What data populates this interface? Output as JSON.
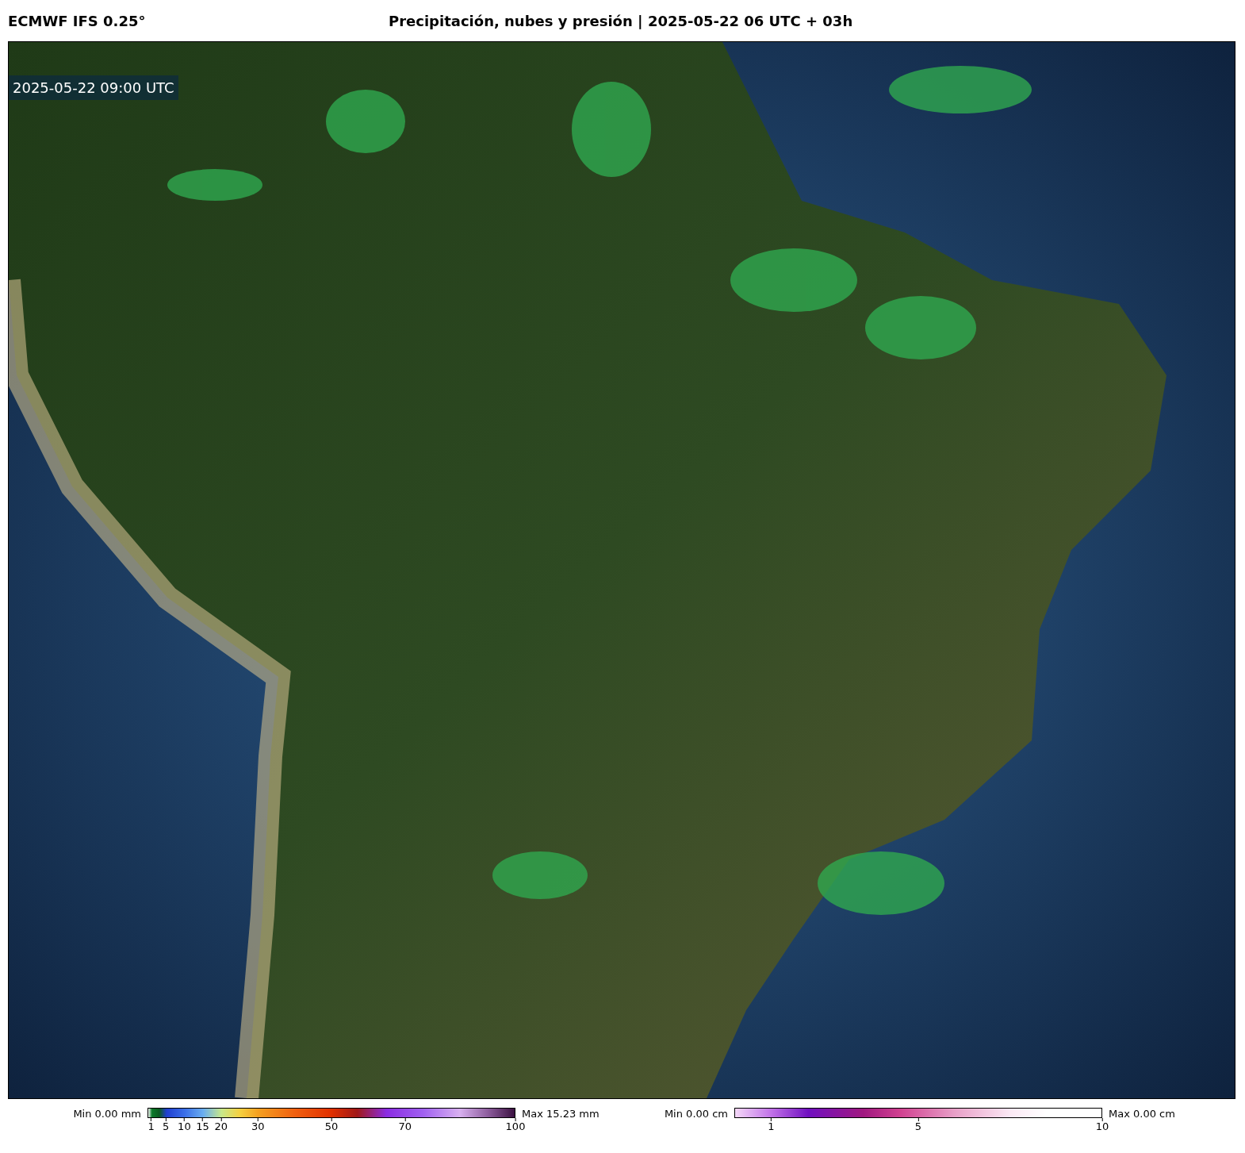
{
  "header": {
    "model": "ECMWF IFS 0.25°",
    "title": "Precipitación, nubes y presión | 2025-05-22 06 UTC + 03h"
  },
  "map": {
    "valid_time": "2025-05-22 09:00 UTC"
  },
  "legends": [
    {
      "kind": "rain",
      "min": "Min 0.00 mm",
      "max": "Max 15.23 mm",
      "ticks": [
        "1",
        "5",
        "10",
        "15",
        "20",
        "30",
        "50",
        "70",
        "100"
      ]
    },
    {
      "kind": "snow",
      "min": "Min 0.00 cm",
      "max": "Max 0.00 cm",
      "ticks": [
        "1",
        "5",
        "10"
      ]
    }
  ]
}
